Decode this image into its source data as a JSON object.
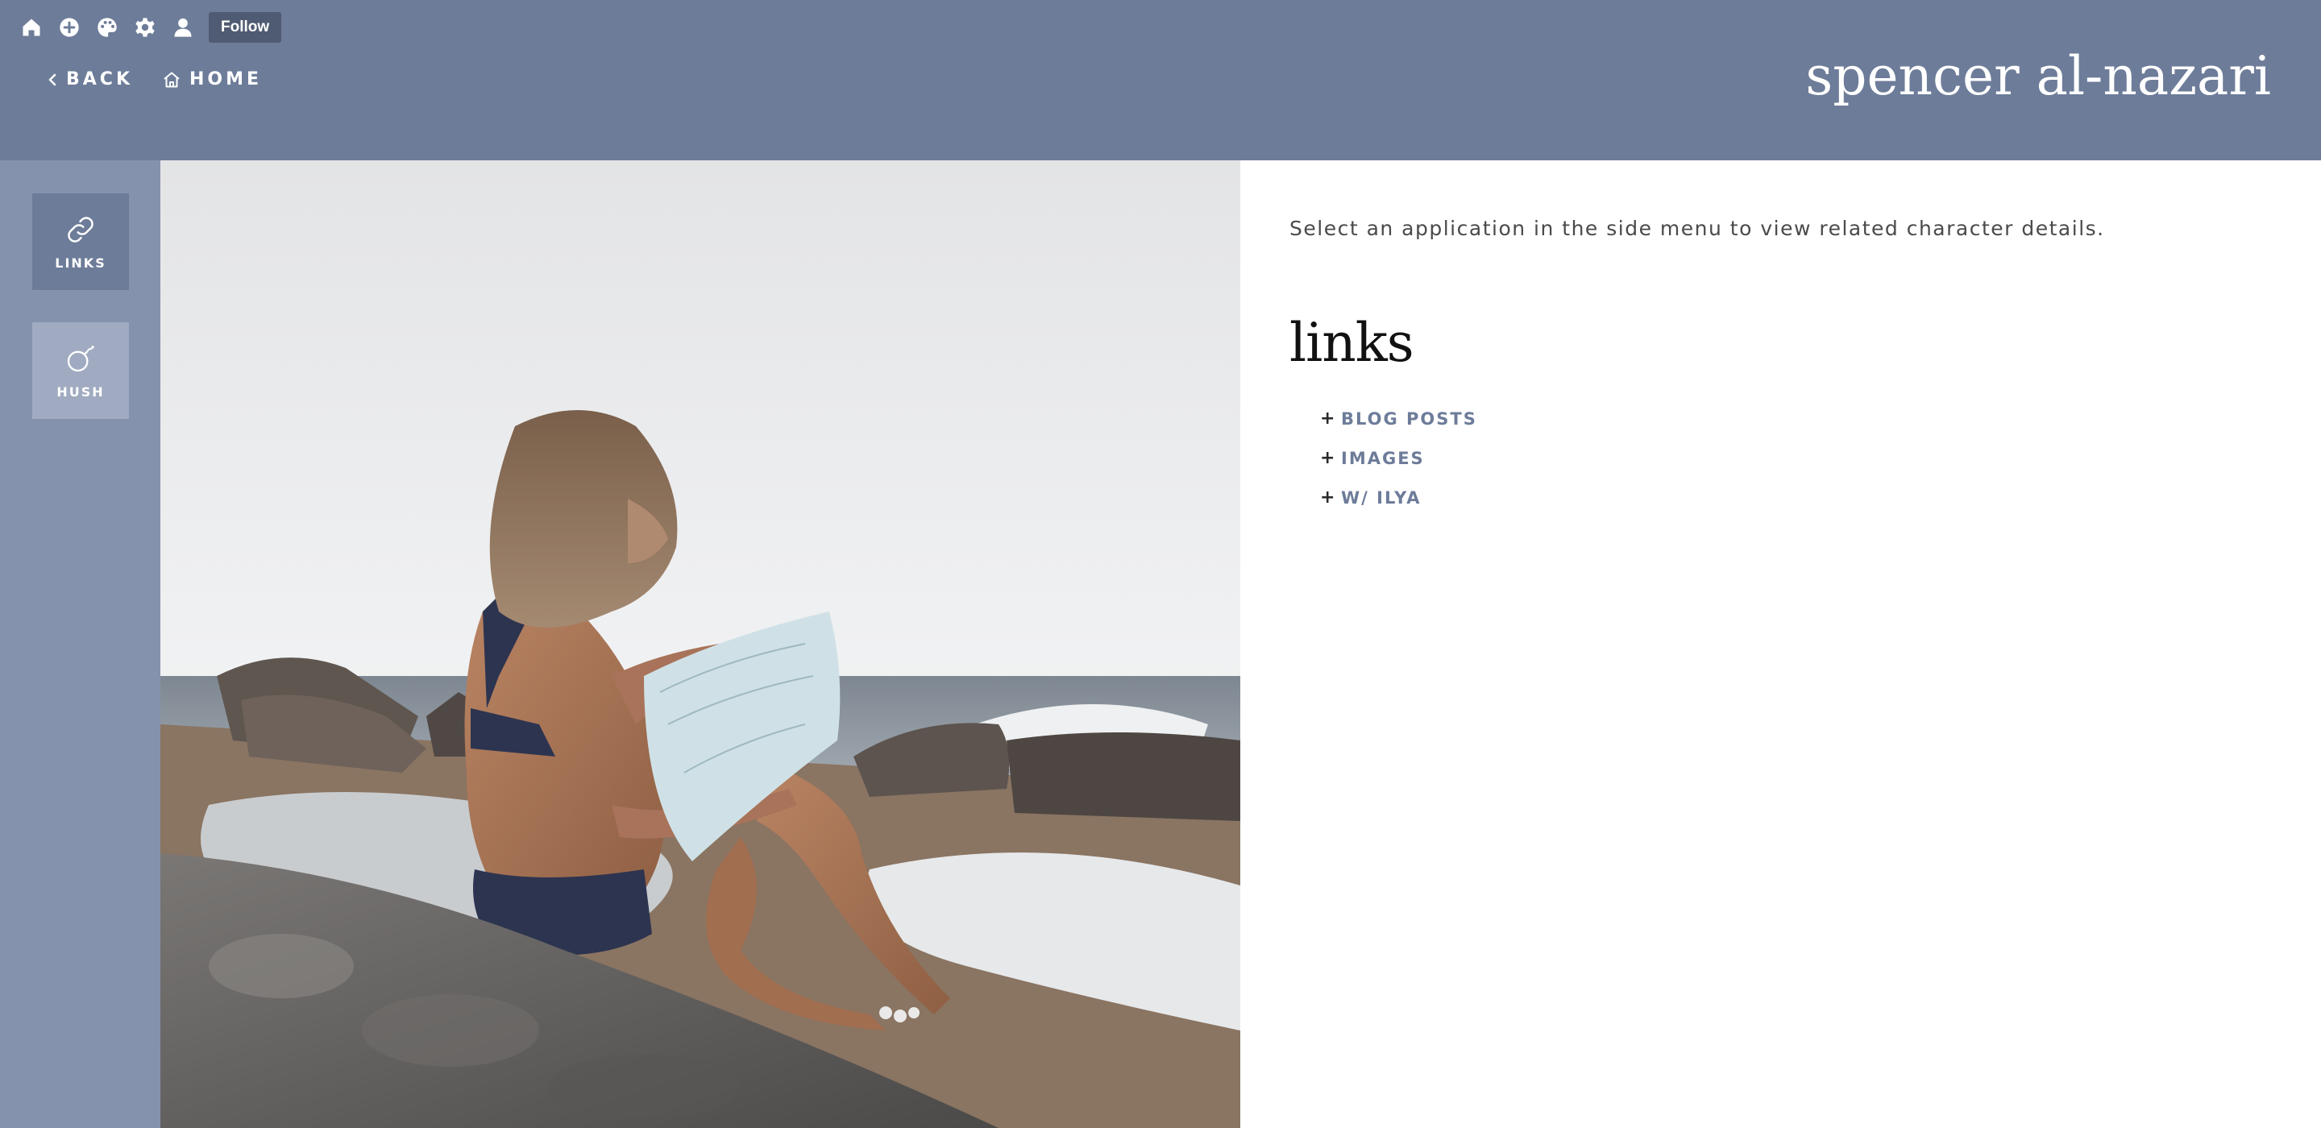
{
  "toolbar": {
    "icons": [
      "home-icon",
      "add-post-icon",
      "palette-icon",
      "gear-icon",
      "user-icon"
    ],
    "follow_label": "Follow"
  },
  "nav": {
    "back_label": "BACK",
    "home_label": "HOME"
  },
  "site_title": "spencer al-nazari",
  "sidebar": {
    "tabs": [
      {
        "label": "LINKS",
        "icon": "link-icon",
        "active": true
      },
      {
        "label": "HUSH",
        "icon": "bomb-icon",
        "active": false
      }
    ]
  },
  "content": {
    "intro": "Select an application in the side menu to view related character details.",
    "section_title": "links",
    "links": [
      {
        "label": "BLOG POSTS"
      },
      {
        "label": "IMAGES"
      },
      {
        "label": "W/ ILYA"
      }
    ]
  },
  "colors": {
    "header_bg": "#6d7c99",
    "sidebar_bg": "#8592ad",
    "active_tab_bg": "#6d7c99",
    "inactive_tab_bg": "#a0abc1",
    "link_color": "#6d7c99",
    "follow_button_bg": "#4f5b72"
  }
}
